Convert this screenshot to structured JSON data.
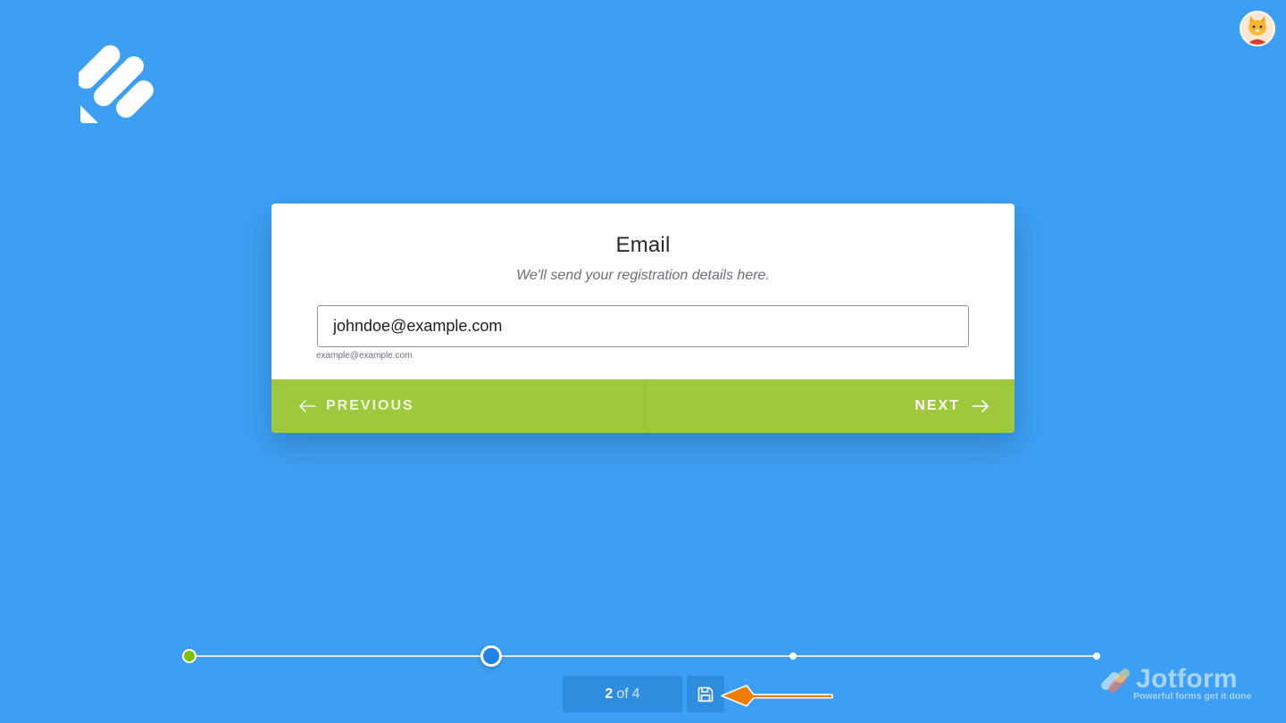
{
  "form": {
    "question_title": "Email",
    "question_subtitle": "We'll send your registration details here.",
    "email_value": "johndoe@example.com",
    "email_sublabel": "example@example.com",
    "previous_label": "PREVIOUS",
    "next_label": "NEXT"
  },
  "progress": {
    "current_page": "2",
    "of_label": "of",
    "total_pages": "4",
    "steps": [
      "completed",
      "current",
      "upcoming",
      "upcoming"
    ]
  },
  "brand": {
    "name": "Jotform",
    "tagline": "Powerful forms get it done"
  },
  "icons": {
    "logo": "form-logo-icon",
    "avatar": "cat-avatar-icon",
    "previous": "arrow-left-icon",
    "next": "arrow-right-icon",
    "save": "floppy-disk-icon",
    "annotation": "orange-pointer-arrow-icon"
  },
  "colors": {
    "background": "#3c9ff3",
    "nav_bar": "#9fc93c",
    "completed_step": "#7cc10a",
    "current_step": "#1f84e6",
    "annotation_arrow": "#f07c00"
  }
}
